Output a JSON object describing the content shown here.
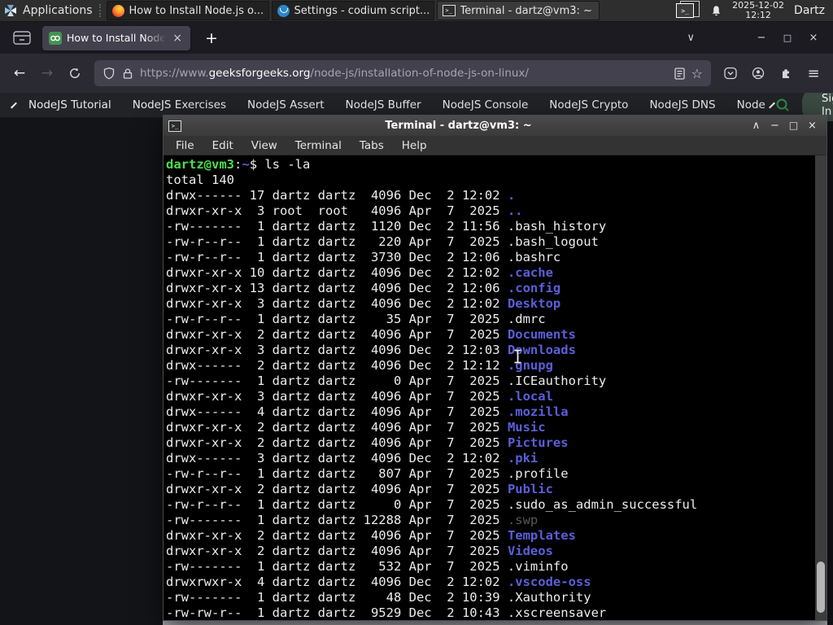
{
  "panel": {
    "applications_label": "Applications",
    "taskbar": [
      {
        "icon": "firefox",
        "label": "How to Install Node.js o...",
        "active": false
      },
      {
        "icon": "codium",
        "label": "Settings - codium script...",
        "active": false
      },
      {
        "icon": "terminal",
        "label": "Terminal - dartz@vm3: ~",
        "active": true
      }
    ],
    "clock_date": "2025-12-02",
    "clock_time": "12:12",
    "user": "Dartz"
  },
  "browser": {
    "tab_title": "How to Install Node.js on",
    "url": {
      "scheme": "https://www.",
      "domain": "geeksforgeeks.org",
      "path": "/node-js/installation-of-node-js-on-linux/"
    }
  },
  "site_nav": {
    "links": [
      "NodeJS Tutorial",
      "NodeJS Exercises",
      "NodeJS Assert",
      "NodeJS Buffer",
      "NodeJS Console",
      "NodeJS Crypto",
      "NodeJS DNS",
      "Node"
    ],
    "sign_in_label": "Sign In"
  },
  "icons": {
    "back": "←",
    "forward": "→",
    "star": "☆",
    "hamburger": "≡",
    "plus": "+",
    "close": "×",
    "minimize": "−",
    "maximize": "□",
    "chevron_down": "∨",
    "shade": "∧",
    "terminal_glyph": ">_"
  },
  "colors": {
    "prompt_green": "#4be04b",
    "dir_blue": "#5b5fd9",
    "gfg_green": "#2f8d46",
    "terminal_bg": "#000000"
  },
  "terminal": {
    "title": "Terminal - dartz@vm3: ~",
    "menu": [
      "File",
      "Edit",
      "View",
      "Terminal",
      "Tabs",
      "Help"
    ],
    "lines": [
      {
        "segs": [
          {
            "t": "dartz@vm3",
            "c": "green"
          },
          {
            "t": ":",
            "c": "fg"
          },
          {
            "t": "~",
            "c": "dir"
          },
          {
            "t": "$ ls -la",
            "c": "fg"
          }
        ]
      },
      {
        "segs": [
          {
            "t": "total 140",
            "c": "fg"
          }
        ]
      },
      {
        "segs": [
          {
            "t": "drwx------ 17 dartz dartz  4096 Dec  2 12:02 ",
            "c": "fg"
          },
          {
            "t": ".",
            "c": "dir"
          }
        ]
      },
      {
        "segs": [
          {
            "t": "drwxr-xr-x  3 root  root   4096 Apr  7  2025 ",
            "c": "fg"
          },
          {
            "t": "..",
            "c": "dir"
          }
        ]
      },
      {
        "segs": [
          {
            "t": "-rw-------  1 dartz dartz  1120 Dec  2 11:56 .bash_history",
            "c": "fg"
          }
        ]
      },
      {
        "segs": [
          {
            "t": "-rw-r--r--  1 dartz dartz   220 Apr  7  2025 .bash_logout",
            "c": "fg"
          }
        ]
      },
      {
        "segs": [
          {
            "t": "-rw-r--r--  1 dartz dartz  3730 Dec  2 12:06 .bashrc",
            "c": "fg"
          }
        ]
      },
      {
        "segs": [
          {
            "t": "drwxr-xr-x 10 dartz dartz  4096 Dec  2 12:02 ",
            "c": "fg"
          },
          {
            "t": ".cache",
            "c": "dir"
          }
        ]
      },
      {
        "segs": [
          {
            "t": "drwxr-xr-x 13 dartz dartz  4096 Dec  2 12:06 ",
            "c": "fg"
          },
          {
            "t": ".config",
            "c": "dir"
          }
        ]
      },
      {
        "segs": [
          {
            "t": "drwxr-xr-x  3 dartz dartz  4096 Dec  2 12:02 ",
            "c": "fg"
          },
          {
            "t": "Desktop",
            "c": "dir"
          }
        ]
      },
      {
        "segs": [
          {
            "t": "-rw-r--r--  1 dartz dartz    35 Apr  7  2025 .dmrc",
            "c": "fg"
          }
        ]
      },
      {
        "segs": [
          {
            "t": "drwxr-xr-x  2 dartz dartz  4096 Apr  7  2025 ",
            "c": "fg"
          },
          {
            "t": "Documents",
            "c": "dir"
          }
        ]
      },
      {
        "segs": [
          {
            "t": "drwxr-xr-x  3 dartz dartz  4096 Dec  2 12:03 ",
            "c": "fg"
          },
          {
            "t": "Downloads",
            "c": "dir"
          }
        ]
      },
      {
        "segs": [
          {
            "t": "drwx------  2 dartz dartz  4096 Dec  2 12:12 ",
            "c": "fg"
          },
          {
            "t": ".gnupg",
            "c": "dir"
          }
        ]
      },
      {
        "segs": [
          {
            "t": "-rw-------  1 dartz dartz     0 Apr  7  2025 .ICEauthority",
            "c": "fg"
          }
        ]
      },
      {
        "segs": [
          {
            "t": "drwxr-xr-x  3 dartz dartz  4096 Apr  7  2025 ",
            "c": "fg"
          },
          {
            "t": ".local",
            "c": "dir"
          }
        ]
      },
      {
        "segs": [
          {
            "t": "drwx------  4 dartz dartz  4096 Apr  7  2025 ",
            "c": "fg"
          },
          {
            "t": ".mozilla",
            "c": "dir"
          }
        ]
      },
      {
        "segs": [
          {
            "t": "drwxr-xr-x  2 dartz dartz  4096 Apr  7  2025 ",
            "c": "fg"
          },
          {
            "t": "Music",
            "c": "dir"
          }
        ]
      },
      {
        "segs": [
          {
            "t": "drwxr-xr-x  2 dartz dartz  4096 Apr  7  2025 ",
            "c": "fg"
          },
          {
            "t": "Pictures",
            "c": "dir"
          }
        ]
      },
      {
        "segs": [
          {
            "t": "drwx------  3 dartz dartz  4096 Dec  2 12:02 ",
            "c": "fg"
          },
          {
            "t": ".pki",
            "c": "dir"
          }
        ]
      },
      {
        "segs": [
          {
            "t": "-rw-r--r--  1 dartz dartz   807 Apr  7  2025 .profile",
            "c": "fg"
          }
        ]
      },
      {
        "segs": [
          {
            "t": "drwxr-xr-x  2 dartz dartz  4096 Apr  7  2025 ",
            "c": "fg"
          },
          {
            "t": "Public",
            "c": "dir"
          }
        ]
      },
      {
        "segs": [
          {
            "t": "-rw-r--r--  1 dartz dartz     0 Apr  7  2025 .sudo_as_admin_successful",
            "c": "fg"
          }
        ]
      },
      {
        "segs": [
          {
            "t": "-rw-------  1 dartz dartz 12288 Apr  7  2025 ",
            "c": "fg"
          },
          {
            "t": ".swp",
            "c": "dim"
          }
        ]
      },
      {
        "segs": [
          {
            "t": "drwxr-xr-x  2 dartz dartz  4096 Apr  7  2025 ",
            "c": "fg"
          },
          {
            "t": "Templates",
            "c": "dir"
          }
        ]
      },
      {
        "segs": [
          {
            "t": "drwxr-xr-x  2 dartz dartz  4096 Apr  7  2025 ",
            "c": "fg"
          },
          {
            "t": "Videos",
            "c": "dir"
          }
        ]
      },
      {
        "segs": [
          {
            "t": "-rw-------  1 dartz dartz   532 Apr  7  2025 .viminfo",
            "c": "fg"
          }
        ]
      },
      {
        "segs": [
          {
            "t": "drwxrwxr-x  4 dartz dartz  4096 Dec  2 12:02 ",
            "c": "fg"
          },
          {
            "t": ".vscode-oss",
            "c": "dir"
          }
        ]
      },
      {
        "segs": [
          {
            "t": "-rw-------  1 dartz dartz    48 Dec  2 10:39 .Xauthority",
            "c": "fg"
          }
        ]
      },
      {
        "segs": [
          {
            "t": "-rw-rw-r--  1 dartz dartz  9529 Dec  2 10:43 .xscreensaver",
            "c": "fg"
          }
        ]
      }
    ]
  }
}
